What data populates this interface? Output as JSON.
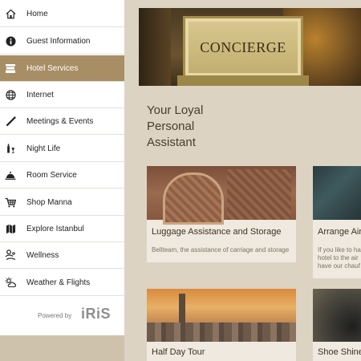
{
  "sidebar": {
    "items": [
      {
        "label": "Home",
        "icon": "home-icon",
        "active": false
      },
      {
        "label": "Guest Information",
        "icon": "info-icon",
        "active": false
      },
      {
        "label": "Hotel Services",
        "icon": "concierge-desk-icon",
        "active": true
      },
      {
        "label": "Internet",
        "icon": "globe-icon",
        "active": false
      },
      {
        "label": "Meetings & Events",
        "icon": "pen-icon",
        "active": false
      },
      {
        "label": "Night Life",
        "icon": "bottle-glass-icon",
        "active": false
      },
      {
        "label": "Room Service",
        "icon": "cloche-icon",
        "active": false
      },
      {
        "label": "Shop Manna",
        "icon": "cart-icon",
        "active": false
      },
      {
        "label": "Explore Istanbul",
        "icon": "map-icon",
        "active": false
      },
      {
        "label": "Wellness",
        "icon": "wellness-icon",
        "active": false
      },
      {
        "label": "Weather & Flights",
        "icon": "weather-icon",
        "active": false
      }
    ],
    "powered_by": "Powered by",
    "logo_text": "iRiS"
  },
  "main": {
    "hero_sign": "CONCIERGE",
    "heading_lines": [
      "Your Loyal",
      "Personal",
      "Assistant"
    ],
    "cards": [
      {
        "title": "Luggage Assistance and Storage",
        "description": "Bellteam, the assistance of carriage and storage"
      },
      {
        "title": "Arrange Air",
        "description_lines": [
          "If you like to ha",
          "hotel to the air",
          "have our chauf"
        ]
      },
      {
        "title": "Half Day Tour",
        "description": ""
      },
      {
        "title": "Shoe Shine",
        "description": ""
      }
    ]
  },
  "colors": {
    "active_item_bg": "#a78e64",
    "overlay_bg": "#dcd3c3",
    "logo_dot": "#e54b3c"
  }
}
